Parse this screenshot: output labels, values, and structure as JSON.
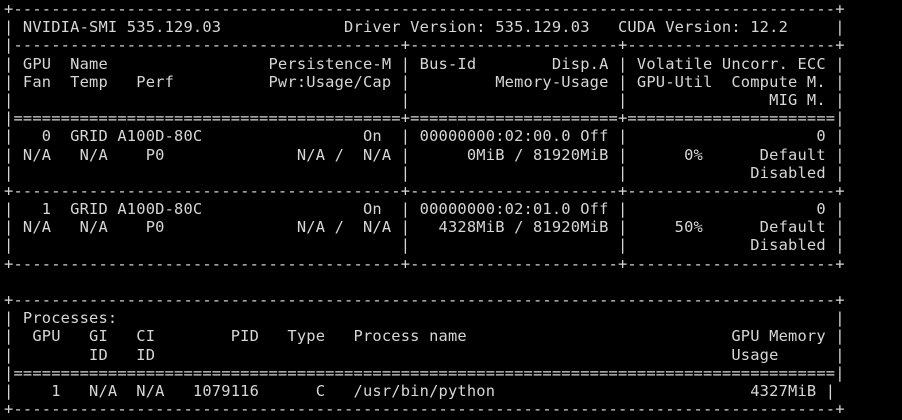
{
  "terminal": {
    "fg_color": "#d6d6d6",
    "bg_color": "#000000",
    "lines": [
      "+---------------------------------------------------------------------------------------+",
      "| NVIDIA-SMI 535.129.03             Driver Version: 535.129.03   CUDA Version: 12.2     |",
      "|-----------------------------------------+----------------------+----------------------+",
      "| GPU  Name                 Persistence-M | Bus-Id        Disp.A | Volatile Uncorr. ECC |",
      "| Fan  Temp   Perf          Pwr:Usage/Cap |         Memory-Usage | GPU-Util  Compute M. |",
      "|                                         |                      |               MIG M. |",
      "|=========================================+======================+======================|",
      "|   0  GRID A100D-80C                 On  | 00000000:02:00.0 Off |                    0 |",
      "| N/A   N/A    P0              N/A /  N/A |      0MiB / 81920MiB |      0%      Default |",
      "|                                         |                      |             Disabled |",
      "+-----------------------------------------+----------------------+----------------------+",
      "|   1  GRID A100D-80C                 On  | 00000000:02:01.0 Off |                    0 |",
      "| N/A   N/A    P0              N/A /  N/A |   4328MiB / 81920MiB |     50%      Default |",
      "|                                         |                      |             Disabled |",
      "+-----------------------------------------+----------------------+----------------------+",
      "",
      "+---------------------------------------------------------------------------------------+",
      "| Processes:                                                                            |",
      "|  GPU   GI   CI        PID   Type   Process name                            GPU Memory |",
      "|        ID   ID                                                             Usage      |",
      "|=======================================================================================|",
      "|    1   N/A  N/A   1079116      C   /usr/bin/python                           4327MiB |",
      "+---------------------------------------------------------------------------------------+"
    ]
  }
}
